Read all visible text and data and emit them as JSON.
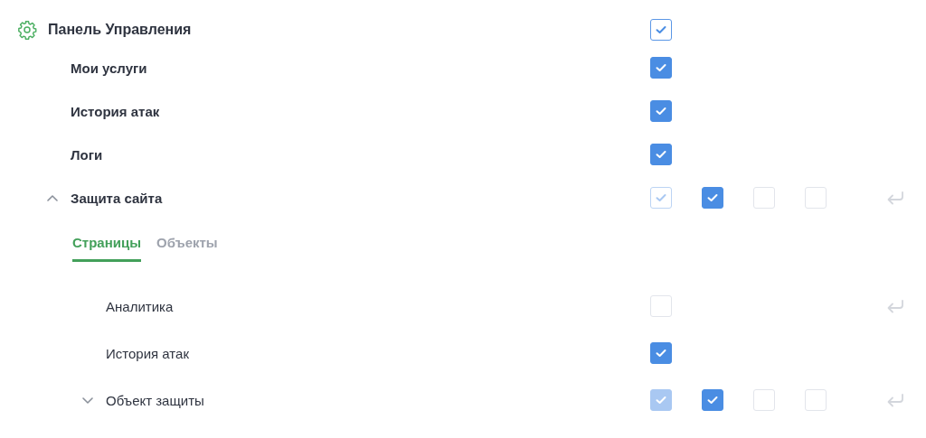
{
  "panel": {
    "title": "Панель Управления",
    "reset": false,
    "checkboxes": [
      {
        "checked": true,
        "kind": "outline"
      }
    ],
    "children": [
      {
        "label": "Мои услуги",
        "reset": false,
        "checkboxes": [
          {
            "checked": true,
            "kind": "filled"
          }
        ]
      },
      {
        "label": "История атак",
        "reset": false,
        "checkboxes": [
          {
            "checked": true,
            "kind": "filled"
          }
        ]
      },
      {
        "label": "Логи",
        "reset": false,
        "checkboxes": [
          {
            "checked": true,
            "kind": "filled"
          }
        ]
      },
      {
        "label": "Защита сайта",
        "expanded": true,
        "reset": true,
        "checkboxes": [
          {
            "checked": true,
            "kind": "faded-outline"
          },
          {
            "checked": true,
            "kind": "filled"
          },
          {
            "checked": false
          },
          {
            "checked": false
          }
        ],
        "tabs": [
          {
            "label": "Страницы",
            "selected": true
          },
          {
            "label": "Объекты",
            "selected": false
          }
        ],
        "children": [
          {
            "label": "Аналитика",
            "reset": true,
            "checkboxes": [
              {
                "checked": false
              }
            ]
          },
          {
            "label": "История атак",
            "reset": false,
            "checkboxes": [
              {
                "checked": true,
                "kind": "filled"
              }
            ]
          },
          {
            "label": "Объект защиты",
            "expanded": false,
            "reset": true,
            "checkboxes": [
              {
                "checked": true,
                "kind": "faded"
              },
              {
                "checked": true,
                "kind": "filled"
              },
              {
                "checked": false
              },
              {
                "checked": false
              }
            ]
          }
        ]
      }
    ]
  }
}
